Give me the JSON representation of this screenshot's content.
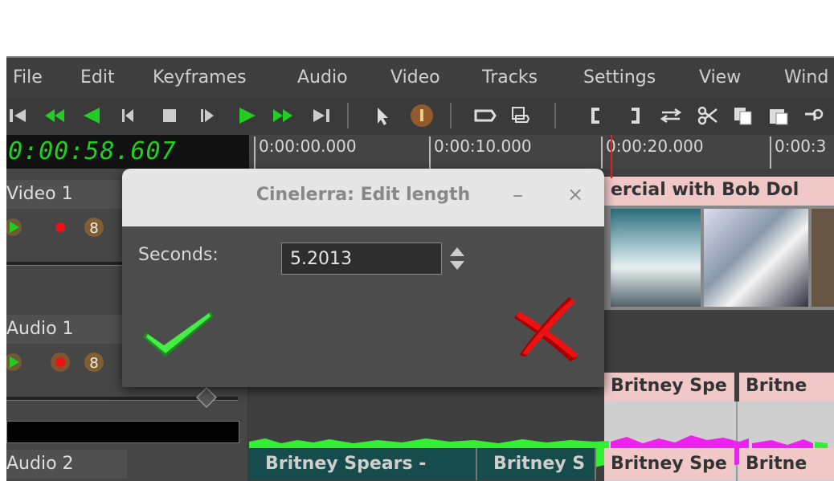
{
  "menubar": {
    "items": [
      "File",
      "Edit",
      "Keyframes",
      "Audio",
      "Video",
      "Tracks",
      "Settings",
      "View",
      "Wind"
    ]
  },
  "toolbar": {
    "buttons": [
      "goto-start-icon",
      "fast-rewind-icon",
      "rewind-icon",
      "frame-back-icon",
      "stop-icon",
      "frame-forward-icon",
      "play-icon",
      "fast-forward-icon",
      "goto-end-icon",
      "arrow-select-icon",
      "text-cursor-icon",
      "label-icon",
      "paste-label-icon",
      "in-point-icon",
      "out-point-icon",
      "loop-icon",
      "cut-icon",
      "copy-icon",
      "paste-icon",
      "more-icon"
    ]
  },
  "clock": {
    "value": "0:00:58.607"
  },
  "ruler": {
    "ticks": [
      "0:00:00.000",
      "0:00:10.000",
      "0:00:20.000",
      "0:00:3"
    ]
  },
  "tracks": [
    {
      "name": "Video 1"
    },
    {
      "name": "Audio 1"
    },
    {
      "name": "Audio 2"
    }
  ],
  "edits": {
    "video": "ercial with Bob Dol",
    "audio1": [
      "Britney Spe",
      "Britne"
    ],
    "audio2": [
      "Britney Spears - ",
      "Britney S",
      "Britney Spe",
      "Britne"
    ]
  },
  "dialog": {
    "title": "Cinelerra: Edit length",
    "min_label": "–",
    "close_label": "×",
    "field_label": "Seconds:",
    "field_value": "5.2013"
  },
  "colors": {
    "accent_green": "#1fd21f",
    "waveform_green": "#33ee33",
    "waveform_magenta": "#ee22ee",
    "cancel_red": "#dd1111"
  }
}
